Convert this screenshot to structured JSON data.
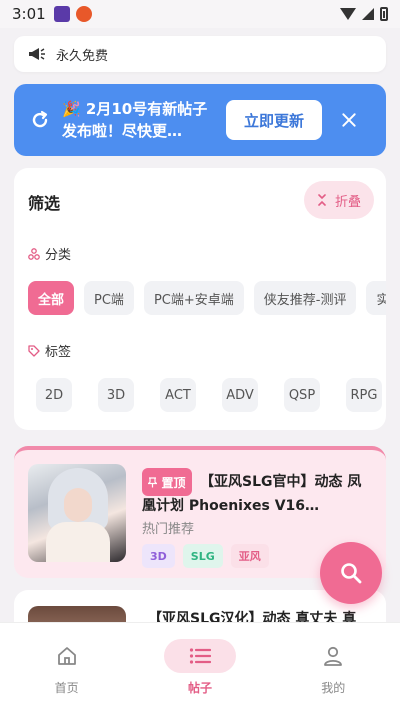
{
  "status_bar": {
    "time": "3:01"
  },
  "notice": {
    "text": "永久免费"
  },
  "update_banner": {
    "message": "🎉 2月10号有新帖子发布啦！尽快更…",
    "button": "立即更新"
  },
  "filter": {
    "title": "筛选",
    "collapse_label": "折叠",
    "category_label": "分类",
    "categories": [
      "全部",
      "PC端",
      "PC端+安卓端",
      "侠友推荐-测评",
      "实"
    ],
    "active_category": "全部",
    "tag_label": "标签",
    "tags": [
      "2D",
      "3D",
      "ACT",
      "ADV",
      "QSP",
      "RPG"
    ]
  },
  "posts": [
    {
      "badge": "置顶",
      "title_line1": "【亚风SLG官中】动态 凤",
      "title_line2": "凰计划 Phoenixes V16…",
      "subtitle": "热门推荐",
      "tags": [
        "3D",
        "SLG",
        "亚风"
      ]
    },
    {
      "title": "【亚风SLG汉化】动态 真丈夫 真"
    }
  ],
  "bottom_nav": {
    "items": [
      "首页",
      "帖子",
      "我的"
    ],
    "active": "帖子"
  },
  "colors": {
    "accent": "#f06b93",
    "banner": "#4d8ef0"
  }
}
